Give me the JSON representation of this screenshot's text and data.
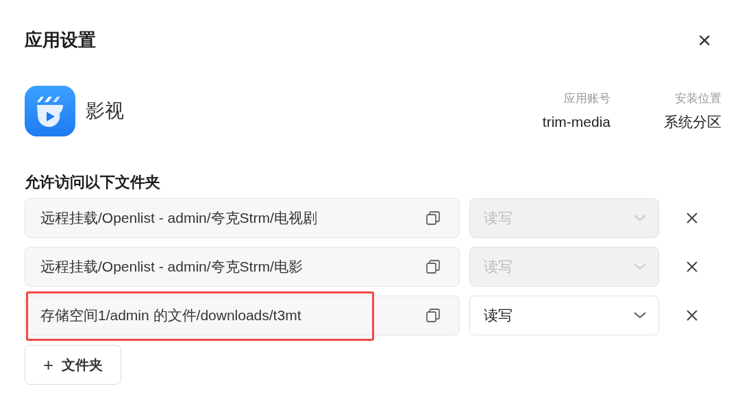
{
  "dialog": {
    "title": "应用设置",
    "close_label": "×"
  },
  "app": {
    "name": "影视",
    "meta": [
      {
        "label": "应用账号",
        "value": "trim-media"
      },
      {
        "label": "安装位置",
        "value": "系统分区"
      }
    ]
  },
  "section_title": "允许访问以下文件夹",
  "folders": [
    {
      "path": "远程挂载/Openlist - admin/夸克Strm/电视剧",
      "permission": "读写",
      "disabled": true,
      "highlighted": false
    },
    {
      "path": "远程挂载/Openlist - admin/夸克Strm/电影",
      "permission": "读写",
      "disabled": true,
      "highlighted": false
    },
    {
      "path": "存储空间1/admin 的文件/downloads/t3mt",
      "permission": "读写",
      "disabled": false,
      "highlighted": true
    }
  ],
  "add_button": {
    "icon": "+",
    "label": "文件夹"
  }
}
